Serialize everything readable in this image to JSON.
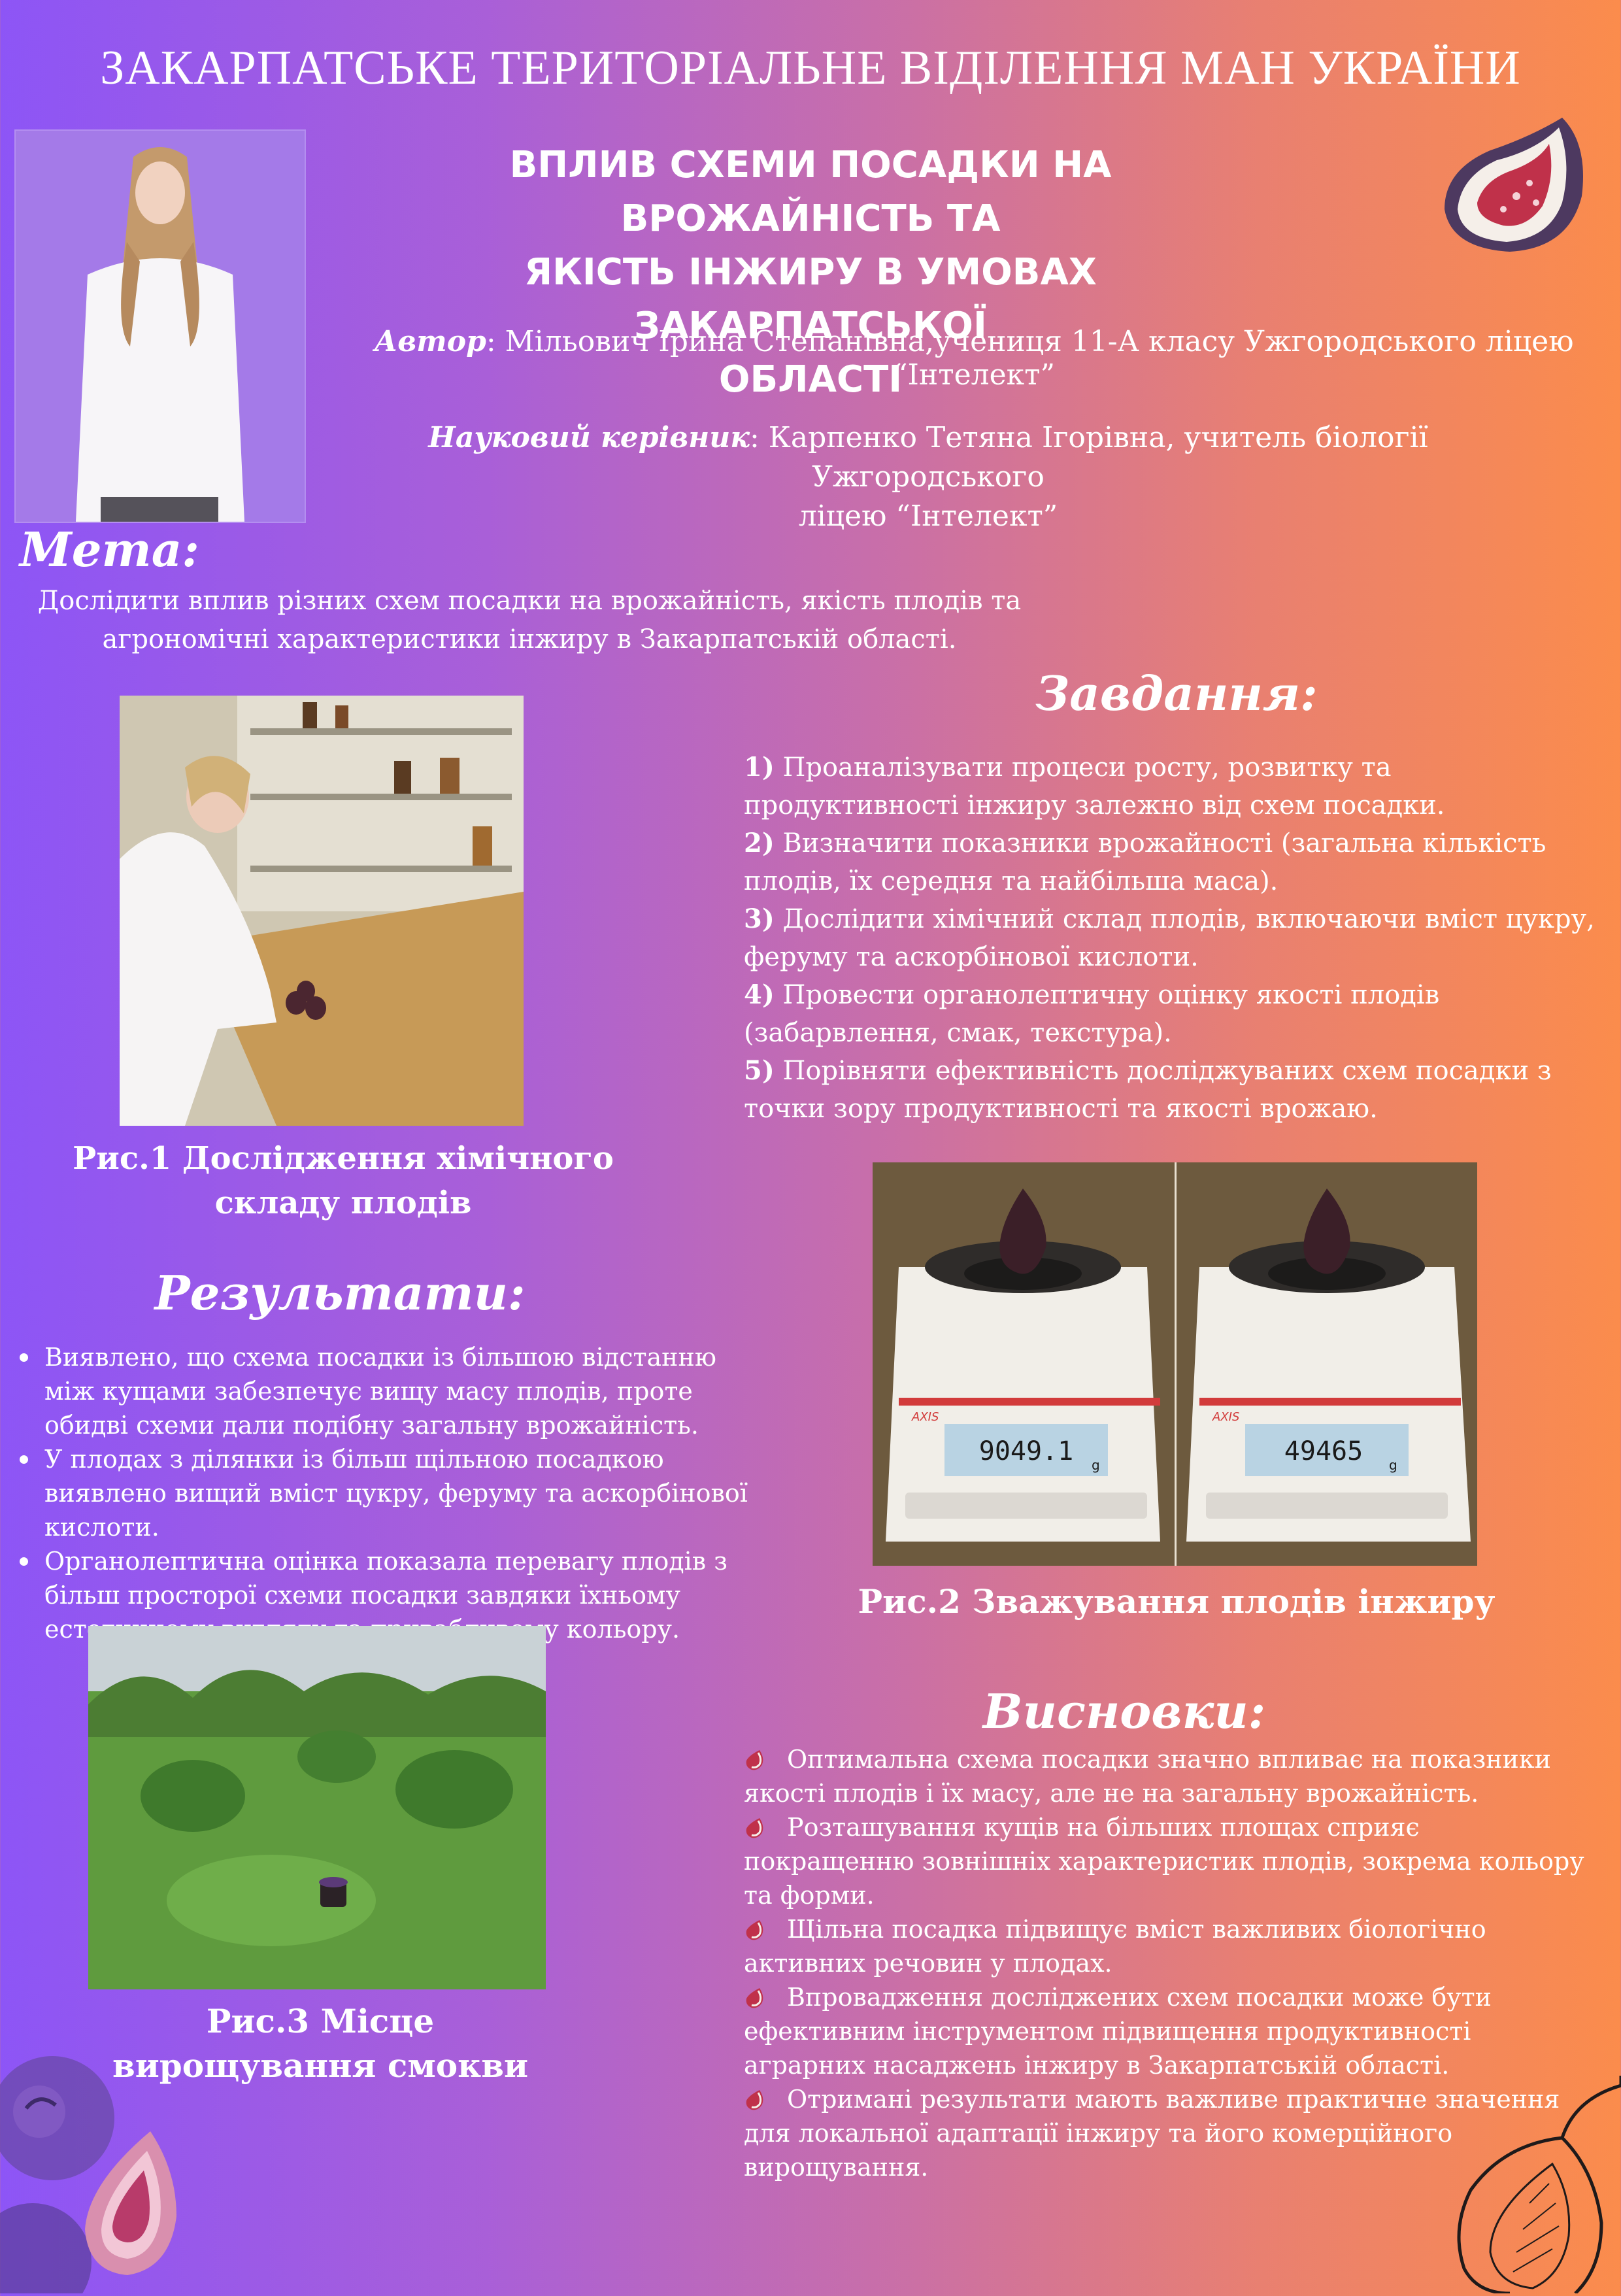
{
  "header": {
    "org": "ЗАКАРПАТСЬКЕ ТЕРИТОРІАЛЬНЕ ВІДІЛЕННЯ МАН УКРАЇНИ",
    "title_lines": [
      "ВПЛИВ СХЕМИ ПОСАДКИ НА ВРОЖАЙНІСТЬ ТА",
      "ЯКІСТЬ ІНЖИРУ В УМОВАХ ЗАКАРПАТСЬКОЇ",
      "ОБЛАСТІ"
    ],
    "author_label": "Автор",
    "author_text": ": Мільович Ірина Степанівна,учениця 11-А класу Ужгородського ліцею “Інтелект”",
    "advisor_label": "Науковий керівник",
    "advisor_text": ": Карпенко Тетяна Ігорівна,   учитель біології  Ужгородського",
    "advisor_text2": "ліцею “Інтелект”"
  },
  "goal": {
    "heading": "Мета:",
    "line1": "Дослідити вплив різних схем посадки на врожайність, якість плодів та",
    "line2": "агрономічні характеристики інжиру в Закарпатській області."
  },
  "tasks": {
    "heading": "Завдання:",
    "items": [
      {
        "num": "1)",
        "text": " Проаналізувати процеси росту, розвитку та продуктивності інжиру залежно від схем посадки."
      },
      {
        "num": "2)",
        "text": " Визначити показники врожайності (загальна кількість плодів, їх середня та найбільша маса)."
      },
      {
        "num": "3)",
        "text": " Дослідити хімічний склад плодів, включаючи вміст цукру, феруму та аскорбінової кислоти."
      },
      {
        "num": "4)",
        "text": " Провести органолептичну оцінку якості плодів (забарвлення, смак, текстура)."
      },
      {
        "num": "5)",
        "text": " Порівняти ефективність досліджуваних схем посадки з точки зору продуктивності та якості врожаю."
      }
    ]
  },
  "figures": {
    "cap1": "Рис.1 Дослідження хімічного складу плодів",
    "cap2": "Рис.2 Зважування плодів інжиру",
    "cap3": "Рис.3 Місце вирощування смокви",
    "scale_left": "9049.1",
    "scale_right": "49465",
    "scale_unit": "g",
    "scale_brand": "AXIS"
  },
  "results": {
    "heading": "Результати:",
    "items": [
      "Виявлено, що схема посадки із більшою відстанню між кущами забезпечує вищу масу плодів, проте обидві схеми дали подібну загальну врожайність.",
      "У плодах з ділянки із більш щільною посадкою виявлено вищий вміст цукру, феруму та аскорбінової кислоти.",
      "Органолептична оцінка показала перевагу плодів з більш просторої схеми посадки завдяки їхньому естетичному вигляду та привабливому кольору."
    ]
  },
  "conclusions": {
    "heading": "Висновки:",
    "items": [
      "Оптимальна схема посадки значно впливає на показники якості плодів і їх масу, але не на загальну врожайність.",
      "Розташування кущів на більших площах сприяє покращенню зовнішніх характеристик плодів, зокрема кольору та форми.",
      "Щільна посадка підвищує вміст важливих біологічно активних речовин у плодах.",
      "Впровадження досліджених схем посадки може бути ефективним інструментом підвищення продуктивності аграрних насаджень інжиру в Закарпатській області.",
      "Отримані результати мають важливе практичне значення для локальної адаптації інжиру та його комерційного вирощування."
    ]
  },
  "colors": {
    "bg_left": "#8d55f6",
    "bg_right": "#fb8c4c",
    "fig_red": "#c0314a",
    "fig_purple": "#5b3a78"
  }
}
